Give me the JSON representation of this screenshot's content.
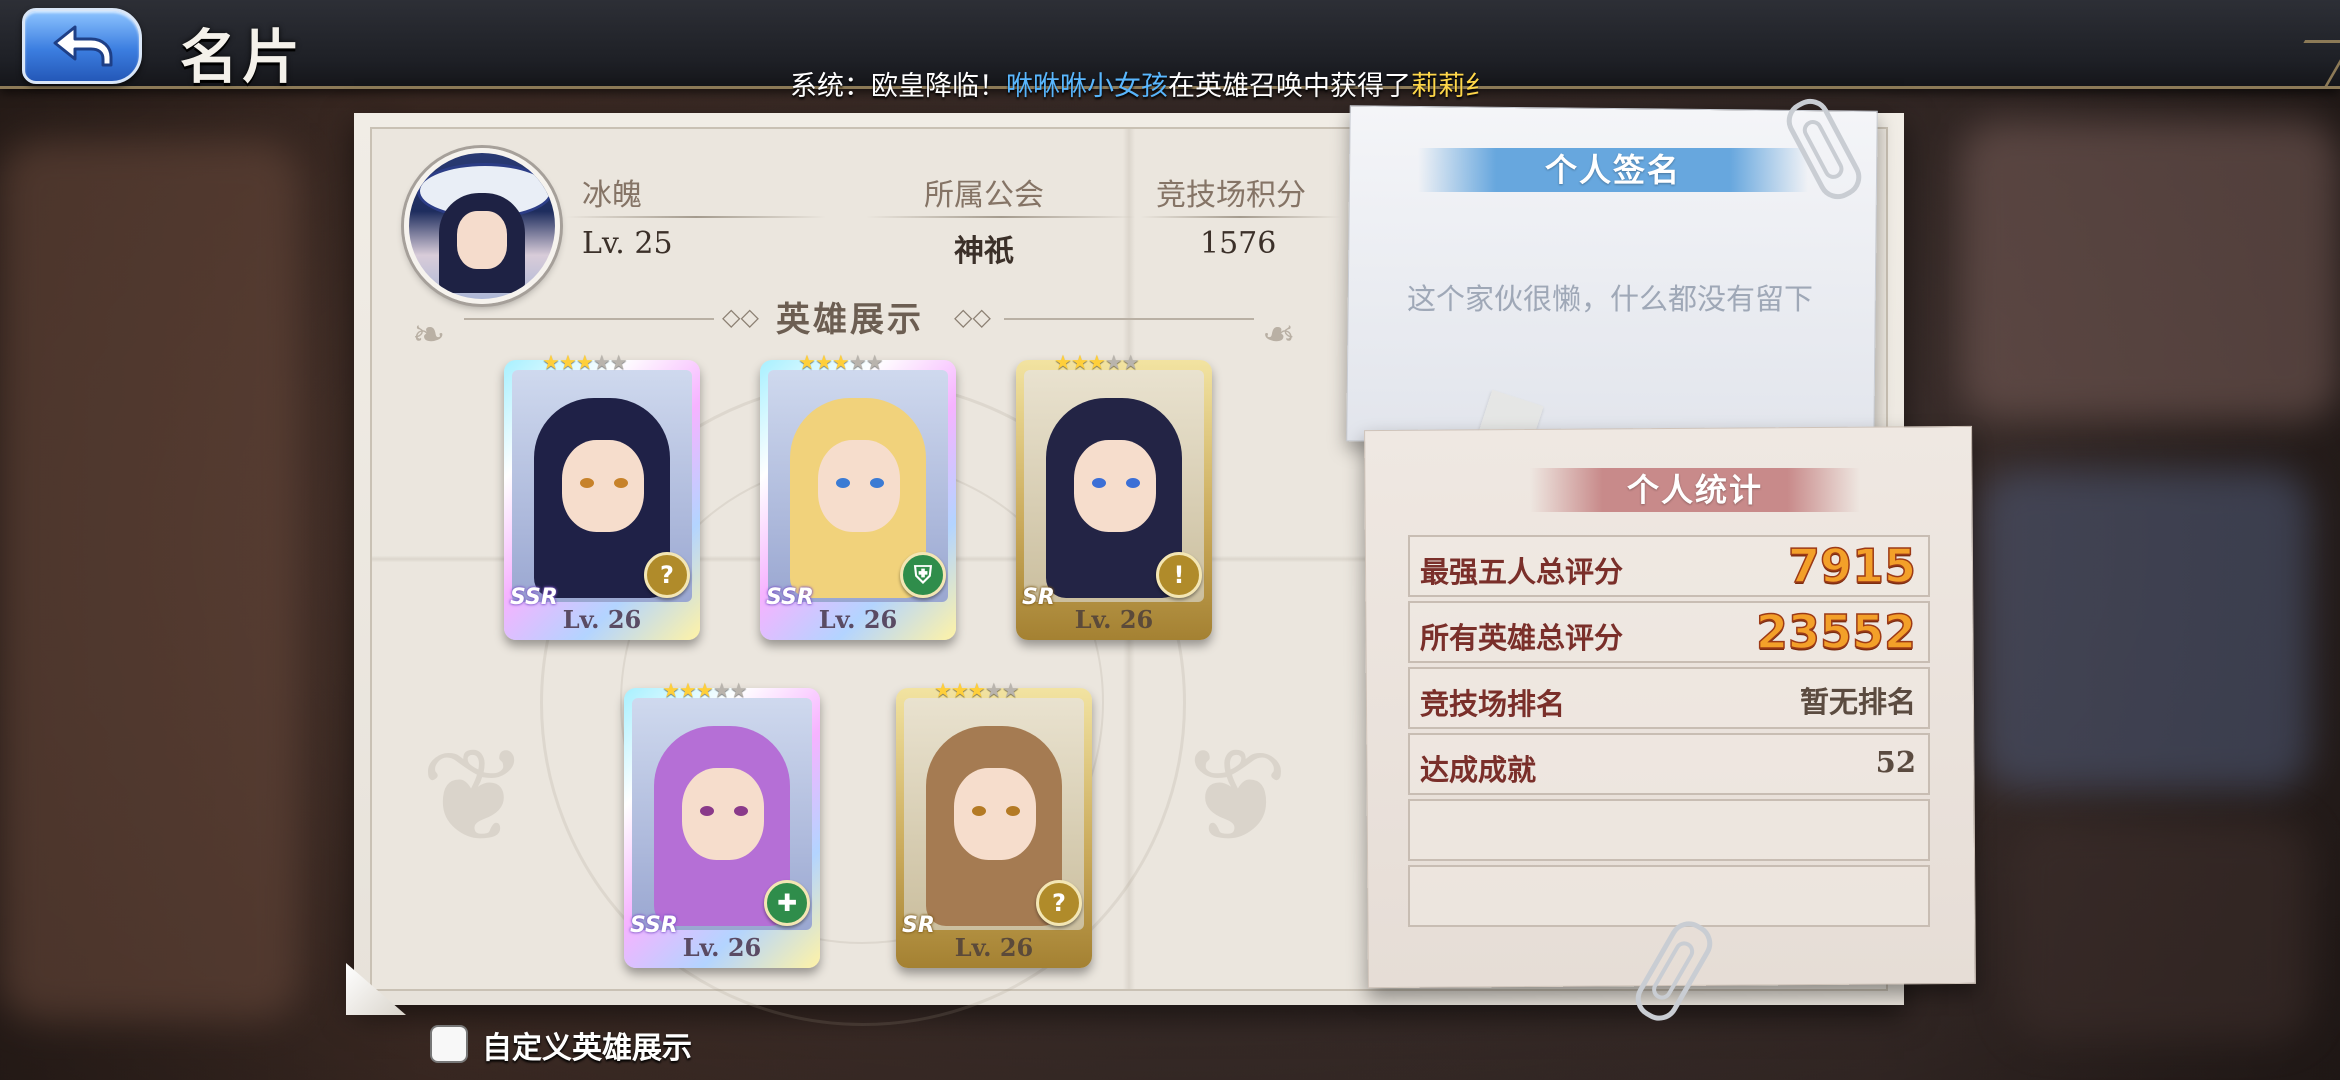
{
  "header": {
    "title": "名片",
    "marquee": {
      "prefix": "系统：欧皇降临！",
      "player": "咻咻咻小女孩",
      "middle": "在英雄召唤中获得了",
      "hero": "莉莉纟"
    }
  },
  "profile": {
    "name": "冰魄",
    "level": "Lv. 25",
    "guild_label": "所属公会",
    "guild_value": "神祇",
    "arena_label": "竞技场积分",
    "arena_value": "1576"
  },
  "hero_showcase": {
    "title": "英雄展示",
    "heroes": [
      {
        "rarity": "SSR",
        "stars": 3,
        "level": "Lv. 26",
        "class_icon": "question-icon",
        "class_symbol": "?",
        "class_color": "#b08b2a",
        "hair_color": "#1f2147",
        "eye_color": "#c7822a"
      },
      {
        "rarity": "SSR",
        "stars": 3,
        "level": "Lv. 26",
        "class_icon": "shield-icon",
        "class_symbol": "⛨",
        "class_color": "#2f8d4b",
        "hair_color": "#f1d27b",
        "eye_color": "#3b7bd4"
      },
      {
        "rarity": "SR",
        "stars": 3,
        "level": "Lv. 26",
        "class_icon": "exclamation-icon",
        "class_symbol": "!",
        "class_color": "#b08b2a",
        "hair_color": "#232445",
        "eye_color": "#3c6fd6"
      },
      {
        "rarity": "SSR",
        "stars": 3,
        "level": "Lv. 26",
        "class_icon": "cross-icon",
        "class_symbol": "✚",
        "class_color": "#2f8d4b",
        "hair_color": "#b56fd6",
        "eye_color": "#8a3a8a"
      },
      {
        "rarity": "SR",
        "stars": 3,
        "level": "Lv. 26",
        "class_icon": "question-icon",
        "class_symbol": "?",
        "class_color": "#b08b2a",
        "hair_color": "#a57b52",
        "eye_color": "#b47a24"
      }
    ]
  },
  "signature": {
    "title": "个人签名",
    "text": "这个家伙很懒，什么都没有留下"
  },
  "stats": {
    "title": "个人统计",
    "rows": [
      {
        "label": "最强五人总评分",
        "value": "7915",
        "style": "big"
      },
      {
        "label": "所有英雄总评分",
        "value": "23552",
        "style": "big"
      },
      {
        "label": "竞技场排名",
        "value": "暂无排名",
        "style": "normal"
      },
      {
        "label": "达成成就",
        "value": "52",
        "style": "normal"
      },
      {
        "label": "",
        "value": "",
        "style": "normal"
      },
      {
        "label": "",
        "value": "",
        "style": "normal"
      }
    ]
  },
  "custom_showcase": {
    "label": "自定义英雄展示",
    "checked": false
  },
  "colors": {
    "accent_blue": "#3c7ee0",
    "gold_score": "#f3a029",
    "stat_label": "#7a2f2a"
  }
}
